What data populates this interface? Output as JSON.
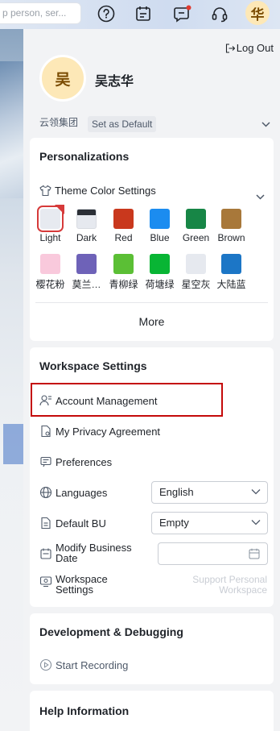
{
  "topbar": {
    "search_placeholder": "p person, ser...",
    "avatar_text": "华"
  },
  "panel": {
    "logout_label": "Log Out",
    "avatar_text": "吴",
    "username": "吴志华",
    "org": "云领集团",
    "set_default_label": "Set as Default"
  },
  "personalizations": {
    "title": "Personalizations",
    "theme_label": "Theme Color Settings",
    "colors": [
      {
        "label": "Light",
        "color": "#e7eaf0",
        "selected": true
      },
      {
        "label": "Dark",
        "color": "#2b2f36"
      },
      {
        "label": "Red",
        "color": "#c9381d"
      },
      {
        "label": "Blue",
        "color": "#1b8cf0"
      },
      {
        "label": "Green",
        "color": "#178646"
      },
      {
        "label": "Brown",
        "color": "#a8783a"
      },
      {
        "label": "樱花粉",
        "color": "#f9c9dc"
      },
      {
        "label": "莫兰…",
        "color": "#6e62b8"
      },
      {
        "label": "青柳绿",
        "color": "#5bbf35"
      },
      {
        "label": "荷塘绿",
        "color": "#08b534"
      },
      {
        "label": "星空灰",
        "color": "#e6e9ef"
      },
      {
        "label": "大陆蓝",
        "color": "#1c76c6"
      }
    ],
    "more_label": "More"
  },
  "workspace": {
    "title": "Workspace Settings",
    "account_label": "Account Management",
    "privacy_label": "My Privacy Agreement",
    "preferences_label": "Preferences",
    "languages_label": "Languages",
    "languages_value": "English",
    "default_bu_label": "Default BU",
    "default_bu_value": "Empty",
    "modify_date_label_1": "Modify Business",
    "modify_date_label_2": "Date",
    "workspace_settings_label_1": "Workspace",
    "workspace_settings_label_2": "Settings",
    "support_personal_1": "Support Personal",
    "support_personal_2": "Workspace"
  },
  "dev": {
    "title": "Development & Debugging",
    "start_recording_label": "Start Recording"
  },
  "help": {
    "title": "Help Information"
  }
}
